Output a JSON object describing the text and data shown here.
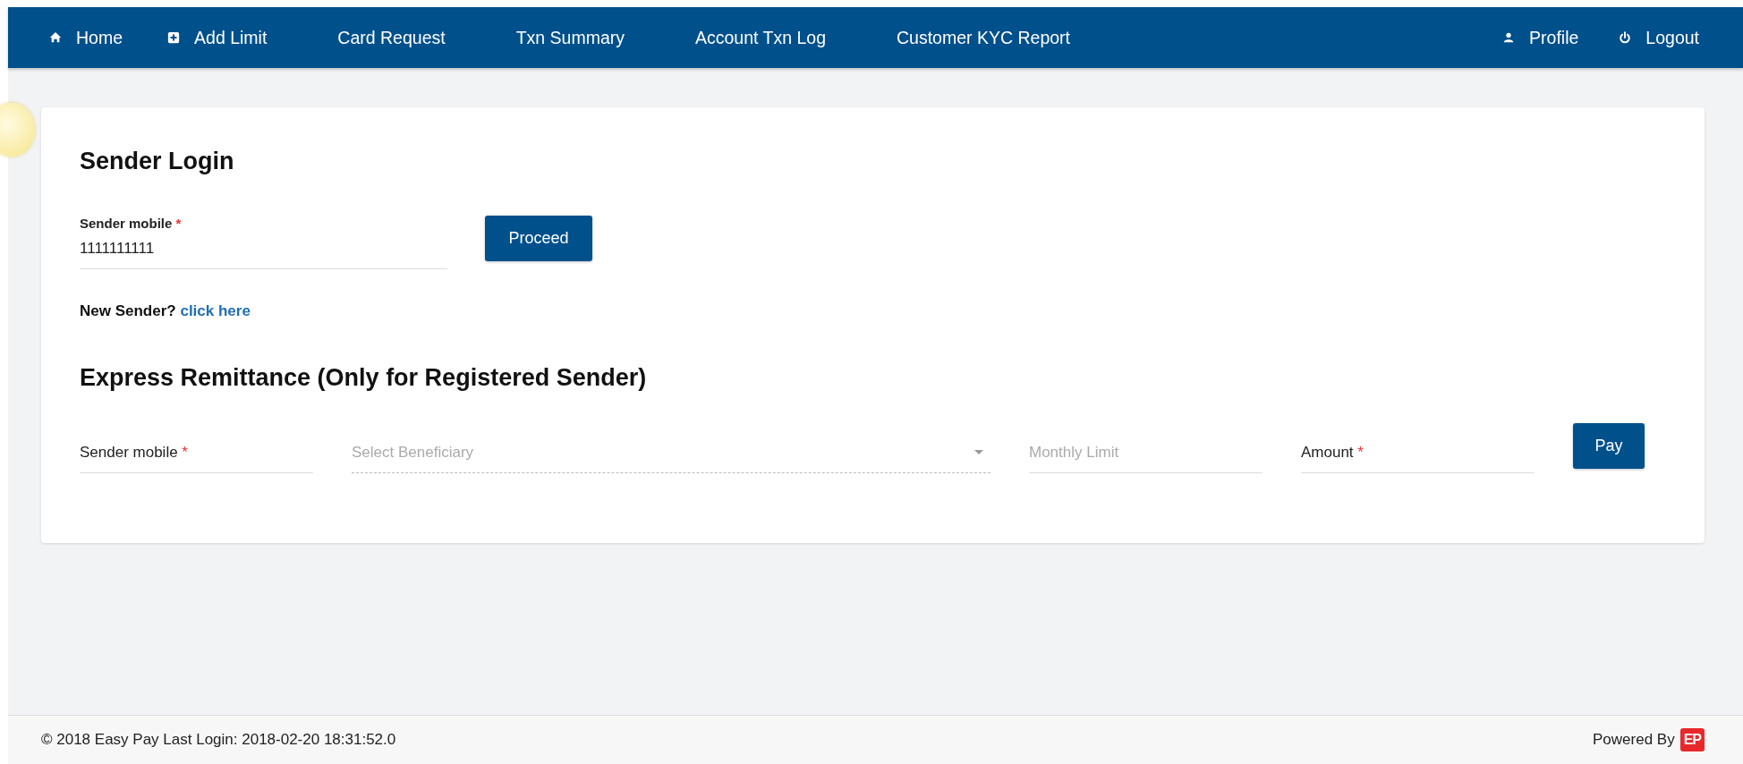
{
  "navbar": {
    "left": [
      "Home",
      "Add Limit",
      "Card Request",
      "Txn Summary",
      "Account Txn Log",
      "Customer KYC Report"
    ],
    "right": [
      "Profile",
      "Logout"
    ]
  },
  "sender_login": {
    "title": "Sender Login",
    "field": {
      "label": "Sender mobile",
      "required_mark": "*",
      "value": "1111111111"
    },
    "button": "Proceed",
    "new_sender": {
      "text": "New Sender?",
      "link": "click here"
    }
  },
  "express": {
    "title": "Express Remittance (Only for Registered Sender)",
    "fields": [
      {
        "kind": "input",
        "label": "Sender mobile",
        "required_mark": "*"
      },
      {
        "kind": "select",
        "placeholder": "Select Beneficiary"
      },
      {
        "kind": "input",
        "placeholder": "Monthly Limit"
      },
      {
        "kind": "input",
        "label": "Amount",
        "required_mark": "*"
      }
    ],
    "button": "Pay"
  },
  "footer": {
    "text": "© 2018 Easy Pay Last Login: 2018-02-20 18:31:52.0",
    "powered_by": "Powered By",
    "logo": "EP"
  }
}
